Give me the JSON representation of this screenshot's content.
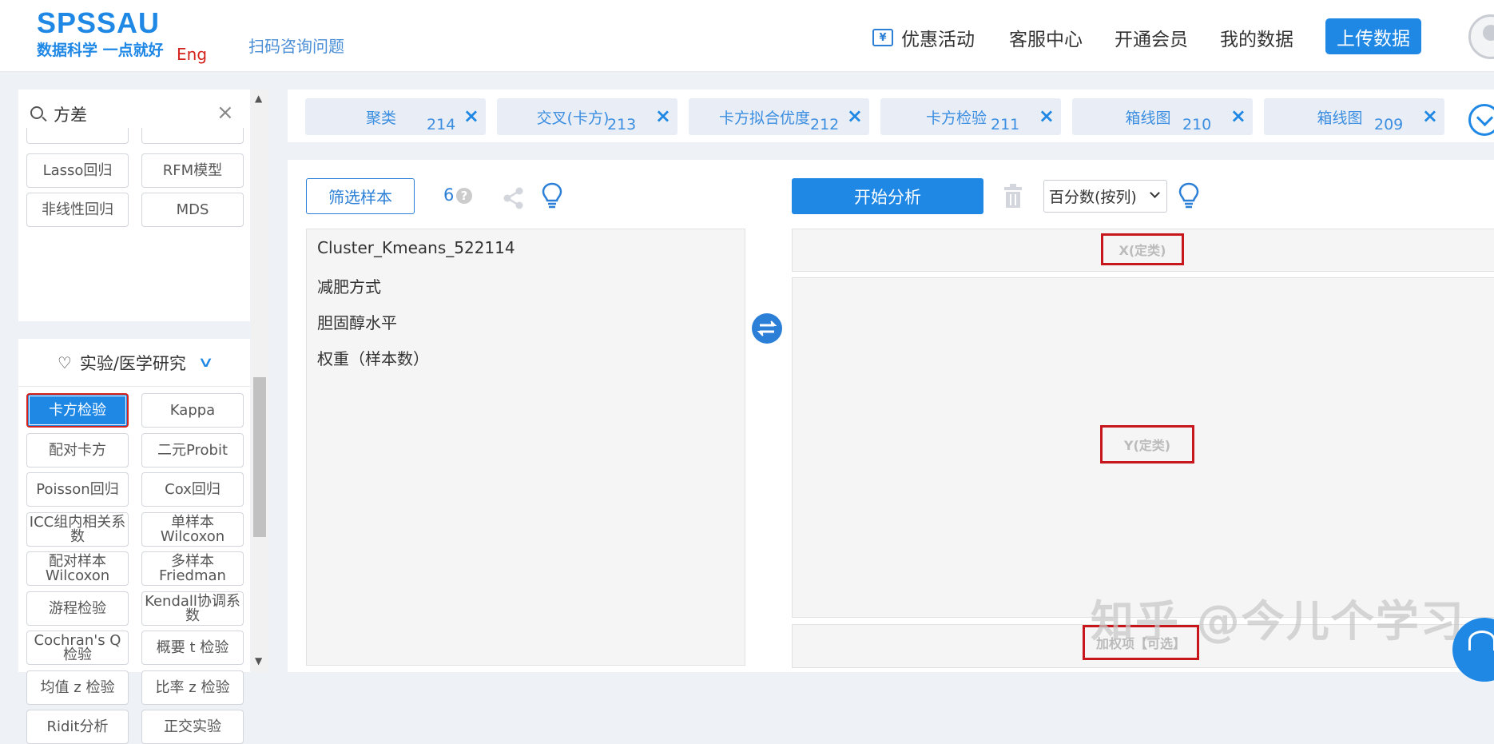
{
  "header": {
    "logo_main": "SPSSAU",
    "logo_sub": "数据科学 一点就好",
    "lang_link": "Eng",
    "qr_link": "扫码咨询问题",
    "nav": {
      "promo": "优惠活动",
      "service": "客服中心",
      "vip": "开通会员",
      "my_data": "我的数据",
      "upload": "上传数据"
    },
    "colors": {
      "accent": "#1f88e5",
      "eng": "#d4221c"
    }
  },
  "sidebar": {
    "search": {
      "value": "方差"
    },
    "top_tools": [
      "Lasso回归",
      "RFM模型",
      "非线性回归",
      "MDS"
    ],
    "category": {
      "label": "实验/医学研究"
    },
    "tools": [
      "卡方检验",
      "Kappa",
      "配对卡方",
      "二元Probit",
      "Poisson回归",
      "Cox回归",
      "ICC组内相关系数",
      "单样本Wilcoxon",
      "配对样本Wilcoxon",
      "多样本Friedman",
      "游程检验",
      "Kendall协调系数",
      "Cochran's Q检验",
      "概要 t 检验",
      "均值 z 检验",
      "比率 z 检验",
      "Ridit分析",
      "正交实验"
    ],
    "selected_tool": "卡方检验"
  },
  "tabs": [
    {
      "label": "聚类",
      "num": "214"
    },
    {
      "label": "交叉(卡方)",
      "num": "213"
    },
    {
      "label": "卡方拟合优度",
      "num": "212"
    },
    {
      "label": "卡方检验",
      "num": "211"
    },
    {
      "label": "箱线图",
      "num": "210"
    },
    {
      "label": "箱线图",
      "num": "209"
    }
  ],
  "main": {
    "filter_label": "筛选样本",
    "sample_count": "6",
    "variables": [
      "Cluster_Kmeans_522114",
      "减肥方式",
      "胆固醇水平",
      "权重（样本数）"
    ],
    "start_label": "开始分析",
    "select_value": "百分数(按列)",
    "zone_x": "X(定类)",
    "zone_y": "Y(定类)",
    "zone_w": "加权项【可选】"
  },
  "watermark": "知乎 @今儿个学习"
}
